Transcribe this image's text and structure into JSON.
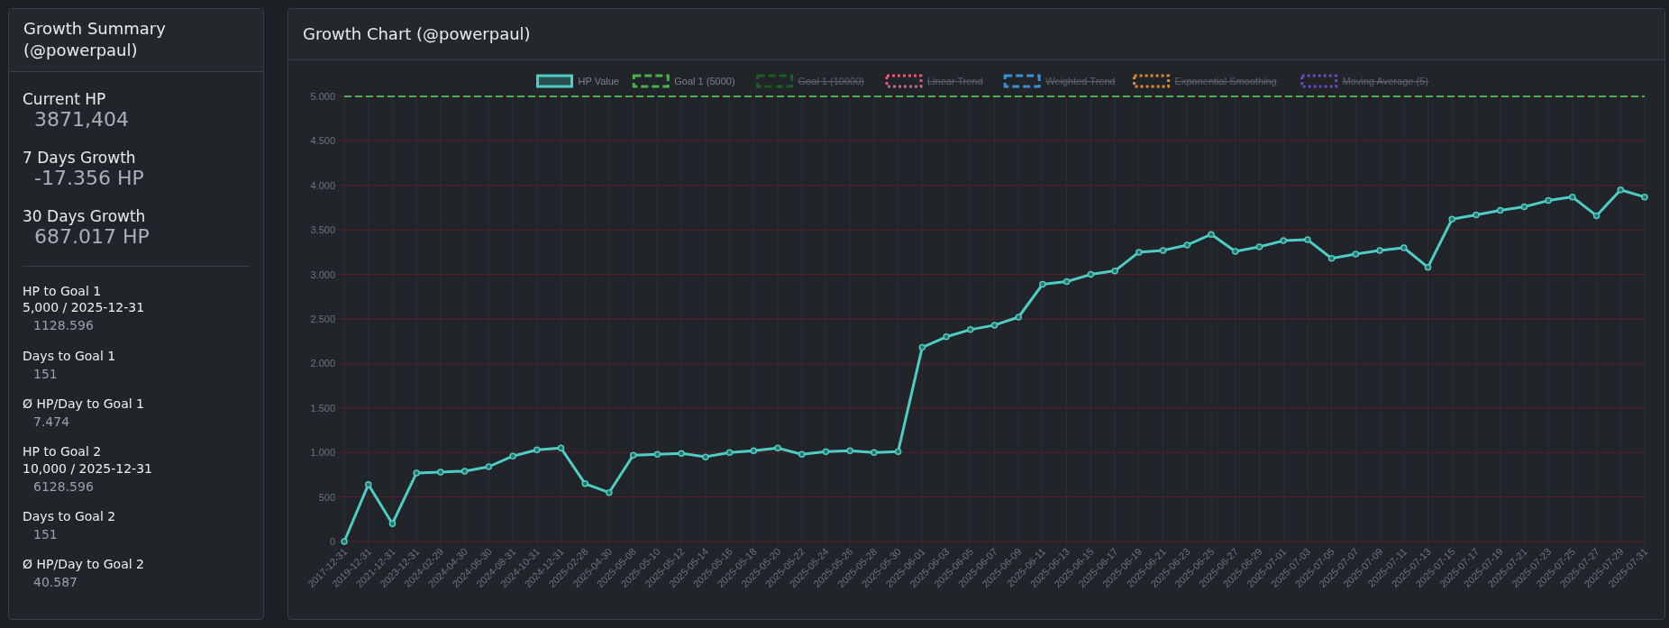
{
  "summary": {
    "title": "Growth Summary (@powerpaul)",
    "highlights": [
      {
        "label": "Current HP",
        "value": "3871,404"
      },
      {
        "label": "7 Days Growth",
        "value": "-17.356 HP"
      },
      {
        "label": "30 Days Growth",
        "value": "687.017 HP"
      }
    ],
    "details": [
      {
        "label": "HP to Goal 1",
        "target": "5,000 / 2025-12-31",
        "value": "1128.596"
      },
      {
        "label": "Days to Goal 1",
        "value": "151"
      },
      {
        "label": "Ø HP/Day to Goal 1",
        "value": "7.474"
      },
      {
        "label": "HP to Goal 2",
        "target": "10,000 / 2025-12-31",
        "value": "6128.596"
      },
      {
        "label": "Days to Goal 2",
        "value": "151"
      },
      {
        "label": "Ø HP/Day to Goal 2",
        "value": "40.587"
      }
    ]
  },
  "chart_panel": {
    "title": "Growth Chart (@powerpaul)",
    "hidden_legend": [
      {
        "label": "Goal 1 (10000)",
        "color": "#1b5e20",
        "kind": "dashed",
        "hidden": true
      },
      {
        "label": "Linear Trend",
        "color": "#e05a7a",
        "kind": "dotted",
        "hidden": true
      },
      {
        "label": "Weighted Trend",
        "color": "#3a8fd0",
        "kind": "dashed",
        "hidden": true
      },
      {
        "label": "Exponential Smoothing",
        "color": "#e08a2a",
        "kind": "dotted",
        "hidden": true
      },
      {
        "label": "Moving Average (5)",
        "color": "#6a4ac0",
        "kind": "dotted",
        "hidden": true
      }
    ],
    "chart_data": {
      "type": "line",
      "grid": true,
      "legend": true,
      "categories": [
        "2017-12-31",
        "2019-12-31",
        "2021-12-31",
        "2023-12-31",
        "2024-02-29",
        "2024-04-30",
        "2024-06-30",
        "2024-08-31",
        "2024-10-31",
        "2024-12-31",
        "2025-02-28",
        "2025-04-30",
        "2025-05-08",
        "2025-05-10",
        "2025-05-12",
        "2025-05-14",
        "2025-05-16",
        "2025-05-18",
        "2025-05-20",
        "2025-05-22",
        "2025-05-24",
        "2025-05-26",
        "2025-05-28",
        "2025-05-30",
        "2025-06-01",
        "2025-06-03",
        "2025-06-05",
        "2025-06-07",
        "2025-06-09",
        "2025-06-11",
        "2025-06-13",
        "2025-06-15",
        "2025-06-17",
        "2025-06-19",
        "2025-06-21",
        "2025-06-23",
        "2025-06-25",
        "2025-06-27",
        "2025-06-29",
        "2025-07-01",
        "2025-07-03",
        "2025-07-05",
        "2025-07-07",
        "2025-07-09",
        "2025-07-11",
        "2025-07-13",
        "2025-07-15",
        "2025-07-17",
        "2025-07-19",
        "2025-07-21",
        "2025-07-23",
        "2025-07-25",
        "2025-07-27",
        "2025-07-29",
        "2025-07-31"
      ],
      "series": [
        {
          "name": "HP Value",
          "color": "#4ecdc4",
          "line_style": "solid",
          "marker": true,
          "values": [
            0,
            640,
            200,
            770,
            780,
            790,
            840,
            960,
            1030,
            1050,
            650,
            550,
            970,
            980,
            990,
            950,
            1000,
            1020,
            1050,
            980,
            1010,
            1020,
            1000,
            1010,
            2180,
            2300,
            2380,
            2430,
            2520,
            2890,
            2920,
            3000,
            3040,
            3250,
            3270,
            3330,
            3450,
            3260,
            3310,
            3380,
            3390,
            3180,
            3230,
            3270,
            3300,
            3080,
            3620,
            3670,
            3720,
            3760,
            3830,
            3870,
            3660,
            3950,
            3870
          ]
        },
        {
          "name": "Goal 1 (5000)",
          "color": "#4caf50",
          "line_style": "dashed",
          "marker": false,
          "values": [
            5000,
            5000,
            5000,
            5000,
            5000,
            5000,
            5000,
            5000,
            5000,
            5000,
            5000,
            5000,
            5000,
            5000,
            5000,
            5000,
            5000,
            5000,
            5000,
            5000,
            5000,
            5000,
            5000,
            5000,
            5000,
            5000,
            5000,
            5000,
            5000,
            5000,
            5000,
            5000,
            5000,
            5000,
            5000,
            5000,
            5000,
            5000,
            5000,
            5000,
            5000,
            5000,
            5000,
            5000,
            5000,
            5000,
            5000,
            5000,
            5000,
            5000,
            5000,
            5000,
            5000,
            5000,
            5000
          ]
        }
      ],
      "ylim": [
        0,
        5000
      ],
      "yticks": [
        {
          "value": 0,
          "label": "0"
        },
        {
          "value": 500,
          "label": "500"
        },
        {
          "value": 1000,
          "label": "1.000"
        },
        {
          "value": 1500,
          "label": "1.500"
        },
        {
          "value": 2000,
          "label": "2.000"
        },
        {
          "value": 2500,
          "label": "2.500"
        },
        {
          "value": 3000,
          "label": "3.000"
        },
        {
          "value": 3500,
          "label": "3.500"
        },
        {
          "value": 4000,
          "label": "4.000"
        },
        {
          "value": 4500,
          "label": "4.500"
        },
        {
          "value": 5000,
          "label": "5.000"
        }
      ]
    }
  }
}
